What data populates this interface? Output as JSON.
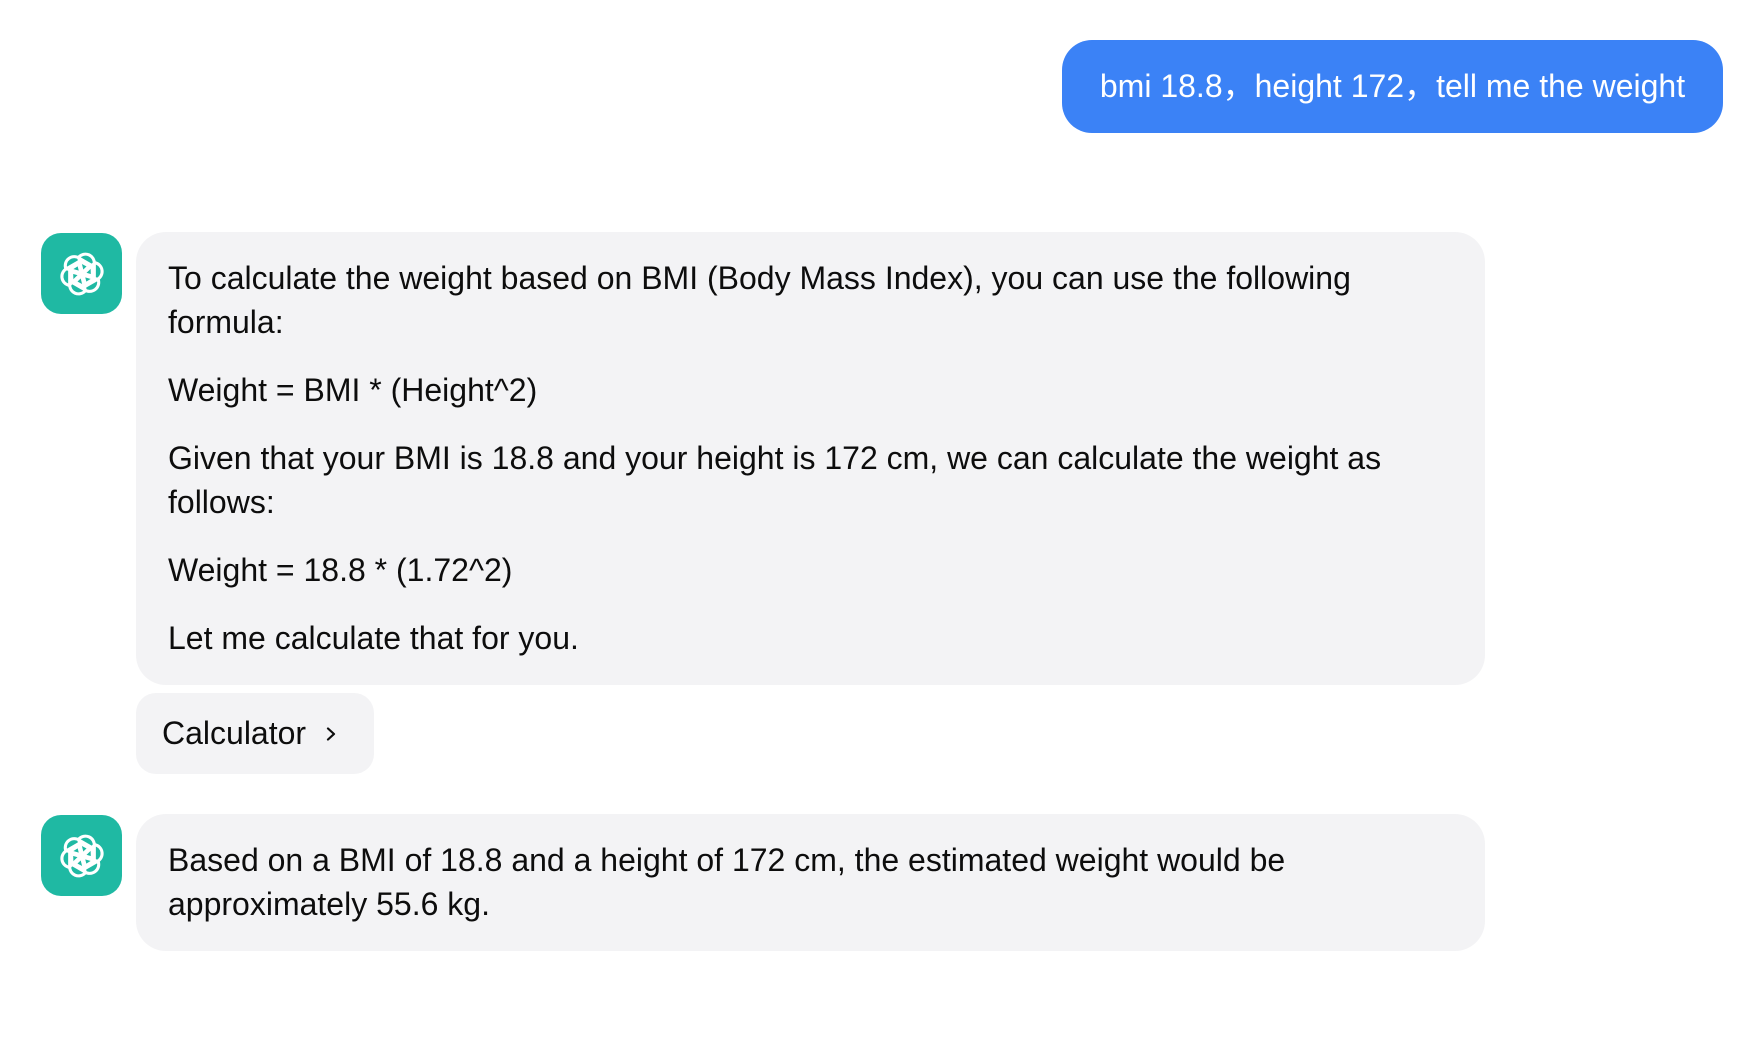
{
  "user_message": {
    "text": "bmi 18.8，height 172，tell me the weight"
  },
  "assistant_messages": [
    {
      "paragraphs": [
        "To calculate the weight based on BMI (Body Mass Index), you can use the following formula:",
        "Weight = BMI * (Height^2)",
        "Given that your BMI is 18.8 and your height is 172 cm, we can calculate the weight as follows:",
        "Weight = 18.8 * (1.72^2)",
        "Let me calculate that for you."
      ],
      "tool": {
        "label": "Calculator",
        "icon": "chevron-right-icon"
      }
    },
    {
      "paragraphs": [
        "Based on a BMI of 18.8 and a height of 172 cm, the estimated weight would be approximately 55.6 kg."
      ]
    }
  ],
  "colors": {
    "user_bubble": "#3b82f6",
    "assistant_avatar": "#1fb9a3",
    "assistant_bubble": "#f3f3f5"
  },
  "icons": {
    "avatar": "openai-logo-icon"
  }
}
